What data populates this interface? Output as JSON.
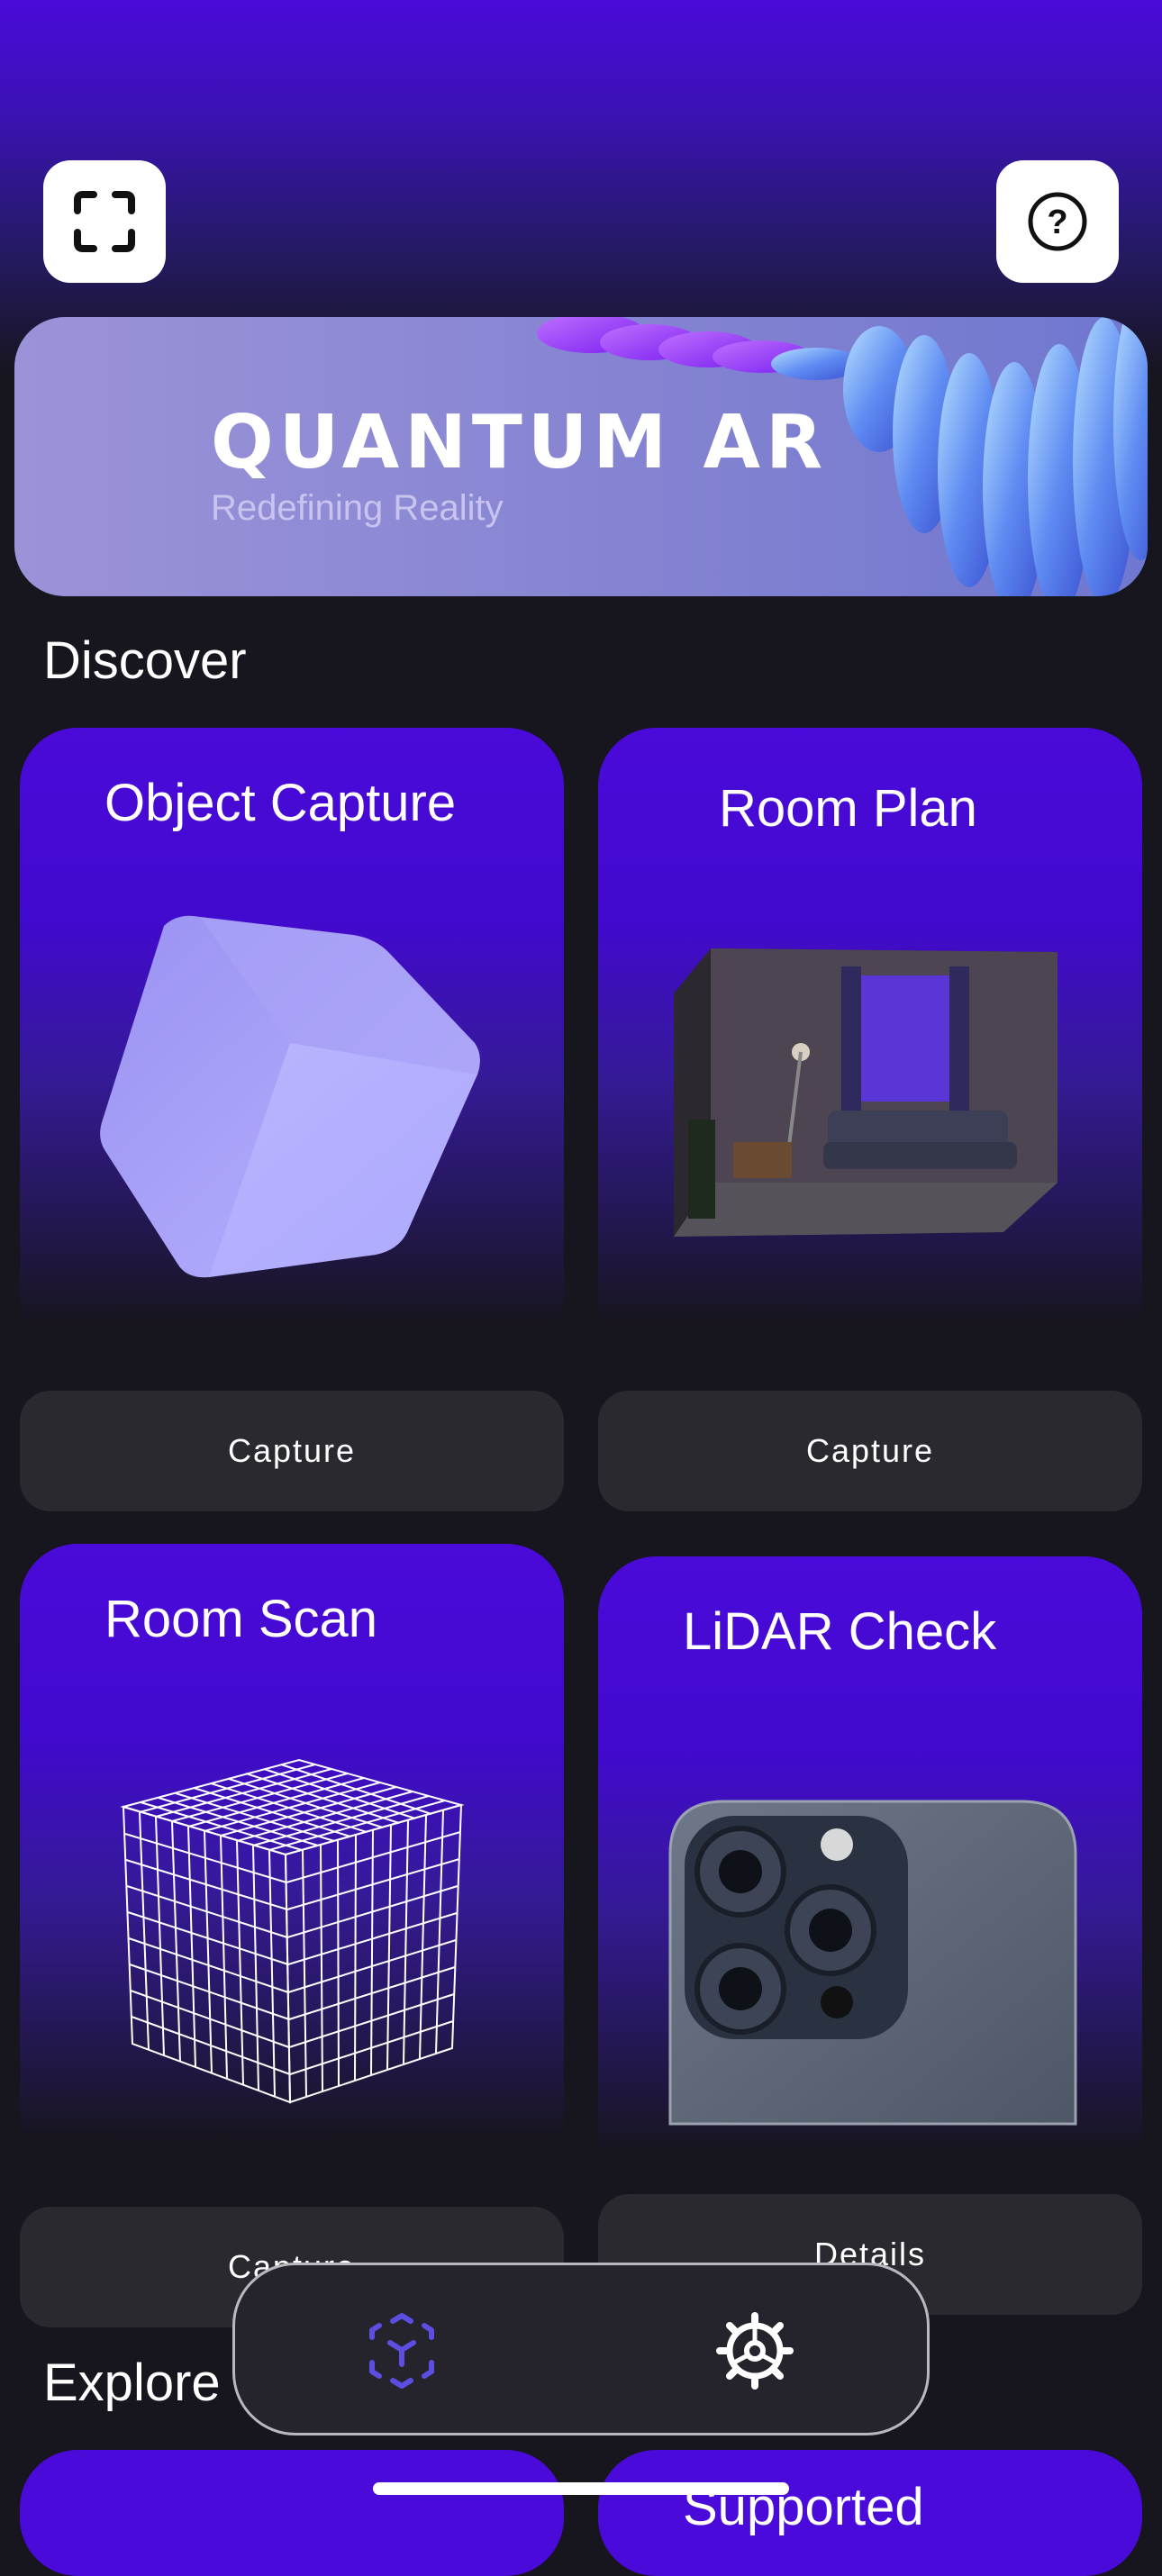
{
  "header": {
    "scan_icon": "scan-frame-icon",
    "help_icon": "question-circle-icon"
  },
  "banner": {
    "title": "QUANTUM AR",
    "subtitle": "Redefining Reality"
  },
  "discover": {
    "title": "Discover",
    "cards": [
      {
        "title": "Object Capture",
        "button": "Capture",
        "image": "cube-object"
      },
      {
        "title": "Room Plan",
        "button": "Capture",
        "image": "room-interior"
      },
      {
        "title": "Room Scan",
        "button": "Capture",
        "image": "wireframe-cube"
      },
      {
        "title": "LiDAR Check",
        "button": "Details",
        "image": "phone-camera"
      }
    ]
  },
  "explore": {
    "title": "Explore",
    "cards": [
      {
        "title": "Supported"
      }
    ]
  },
  "tabbar": {
    "items": [
      {
        "icon": "ar-cube-icon",
        "active": true
      },
      {
        "icon": "gear-icon",
        "active": false
      }
    ]
  },
  "colors": {
    "accent": "#4a0ad9",
    "background": "#17151d",
    "button": "#2a2930",
    "active_tab": "#5b4ee0"
  }
}
